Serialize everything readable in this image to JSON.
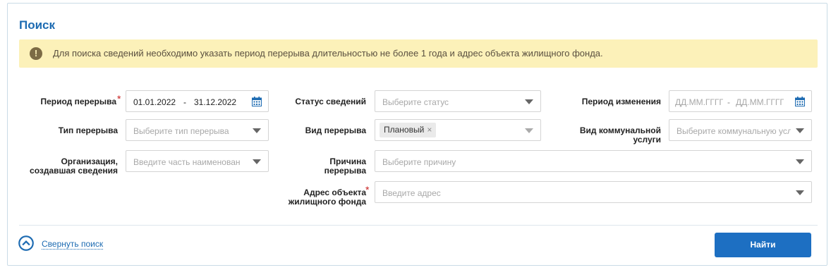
{
  "search": {
    "title": "Поиск",
    "alert": "Для поиска сведений необходимо указать период перерыва длительностью не более 1 года и адрес объекта жилищного фонда.",
    "alert_icon": "exclamation-icon",
    "required_mark": "*",
    "fields": {
      "break_period": {
        "label": "Период перерыва",
        "from": "01.01.2022",
        "separator": "-",
        "to": "31.12.2022"
      },
      "break_type": {
        "label": "Тип перерыва",
        "placeholder": "Выберите тип перерыва"
      },
      "organization": {
        "label_line1": "Организация,",
        "label_line2": "создавшая сведения",
        "placeholder": "Введите часть наименован"
      },
      "status": {
        "label": "Статус сведений",
        "placeholder": "Выберите статус"
      },
      "break_kind": {
        "label": "Вид перерыва",
        "tag": "Плановый",
        "tag_remove": "×"
      },
      "reason": {
        "label_line1": "Причина",
        "label_line2": "перерыва",
        "placeholder": "Выберите причину"
      },
      "address": {
        "label_line1": "Адрес объекта",
        "label_line2": "жилищного фонда",
        "placeholder": "Введите адрес"
      },
      "change_period": {
        "label": "Период изменения",
        "from_placeholder": "ДД.ММ.ГГГГ",
        "separator": "-",
        "to_placeholder": "ДД.ММ.ГГГГ"
      },
      "service_kind": {
        "label_line1": "Вид коммунальной",
        "label_line2": "услуги",
        "placeholder": "Выберите коммунальную усл"
      }
    },
    "collapse_label": "Свернуть поиск",
    "find_button": "Найти",
    "colors": {
      "accent": "#1d6bb2",
      "alert_bg": "#fcf1b9",
      "required": "#c81d1d"
    }
  }
}
